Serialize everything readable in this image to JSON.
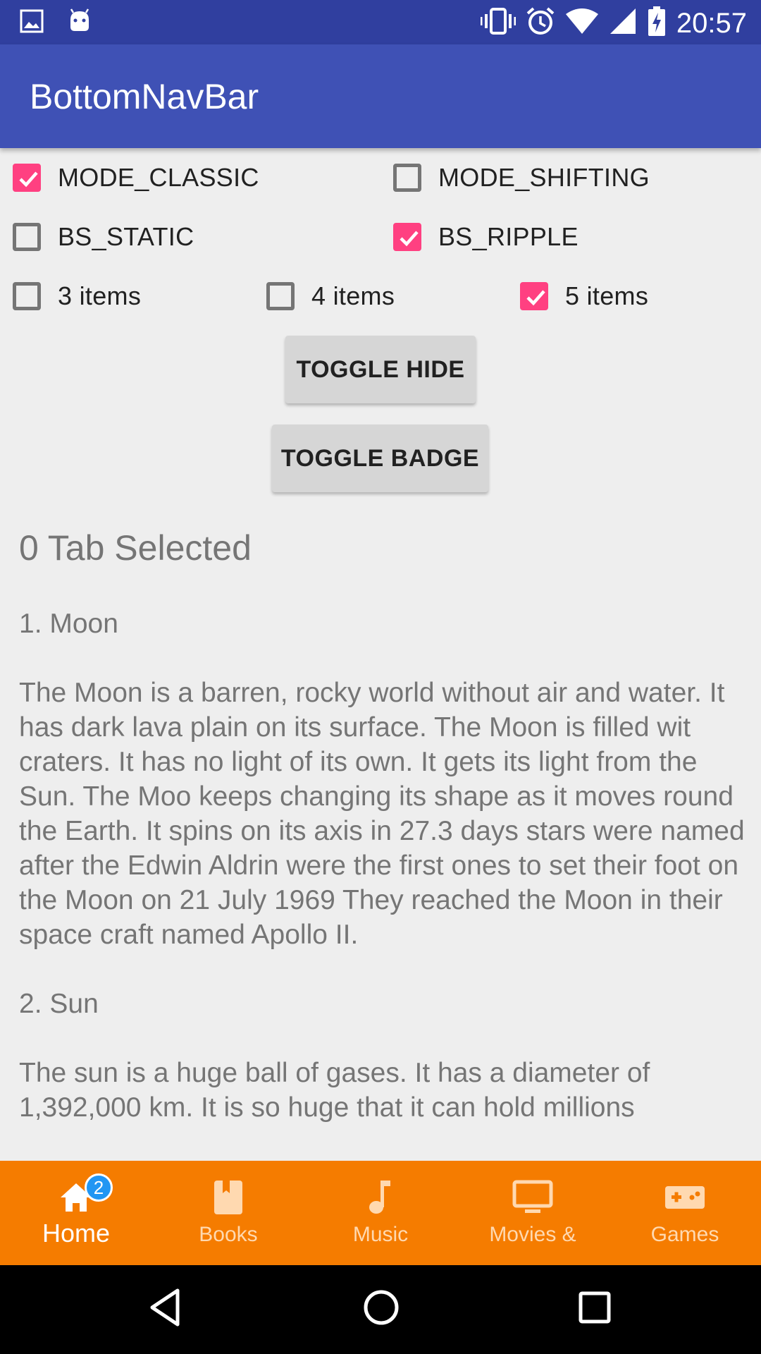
{
  "status_bar": {
    "time": "20:57",
    "icons": [
      "image-icon",
      "android-icon",
      "vibrate-icon",
      "alarm-icon",
      "wifi-icon",
      "signal-icon",
      "battery-charging-icon"
    ]
  },
  "app_bar": {
    "title": "BottomNavBar"
  },
  "options": {
    "mode_classic": {
      "label": "MODE_CLASSIC",
      "checked": true
    },
    "mode_shifting": {
      "label": "MODE_SHIFTING",
      "checked": false
    },
    "bs_static": {
      "label": "BS_STATIC",
      "checked": false
    },
    "bs_ripple": {
      "label": "BS_RIPPLE",
      "checked": true
    },
    "items_3": {
      "label": "3 items",
      "checked": false
    },
    "items_4": {
      "label": "4 items",
      "checked": false
    },
    "items_5": {
      "label": "5 items",
      "checked": true
    }
  },
  "buttons": {
    "toggle_hide": "TOGGLE HIDE",
    "toggle_badge": "TOGGLE BADGE"
  },
  "tab_selected": "0 Tab Selected",
  "content": {
    "heading1": "1. Moon",
    "para1": "The Moon is a barren, rocky world without air and water. It has dark lava plain on its surface. The Moon is filled wit craters. It has no light of its own. It gets its light from the Sun. The Moo keeps changing its shape as it moves round the Earth. It spins on its axis in 27.3 days stars were named after the Edwin Aldrin were the first ones to set their foot on the Moon on 21 July 1969 They reached the Moon in their space craft named Apollo II.",
    "heading2": "2. Sun",
    "para2": "The sun is a huge ball of gases. It has a diameter of 1,392,000 km. It is so huge that it can hold millions"
  },
  "bottom_nav": {
    "items": [
      {
        "label": "Home",
        "icon": "home-icon",
        "badge": "2",
        "active": true
      },
      {
        "label": "Books",
        "icon": "book-icon",
        "active": false
      },
      {
        "label": "Music",
        "icon": "music-note-icon",
        "active": false
      },
      {
        "label": "Movies &",
        "icon": "tv-icon",
        "active": false
      },
      {
        "label": "Games",
        "icon": "gamepad-icon",
        "active": false
      }
    ]
  },
  "colors": {
    "status_bar": "#303f9f",
    "app_bar": "#3f51b5",
    "accent": "#ff4081",
    "bottom_nav": "#f57c00",
    "badge": "#2196f3"
  }
}
